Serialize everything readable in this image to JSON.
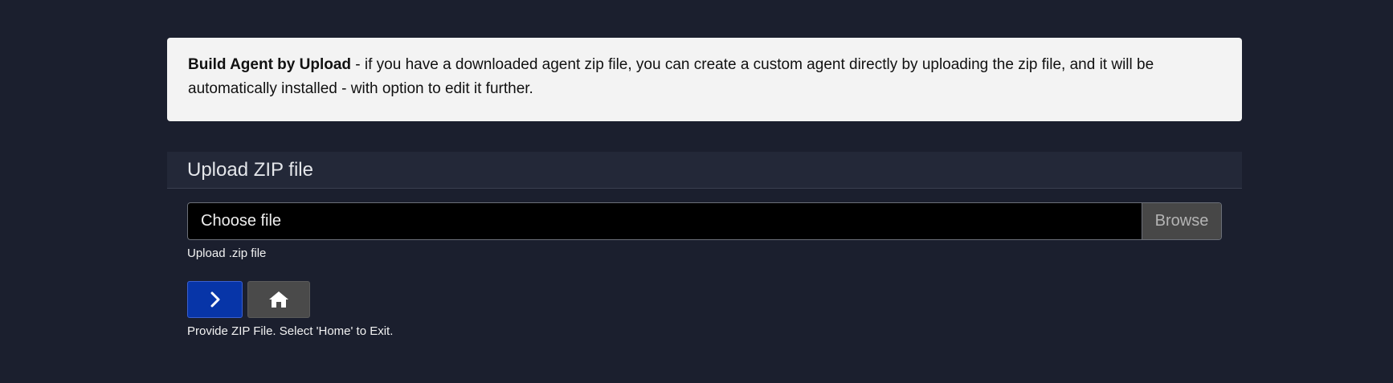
{
  "info": {
    "title": "Build Agent by Upload",
    "description": " - if you have a downloaded agent zip file, you can create a custom agent directly by uploading the zip file, and it will be automatically installed - with option to edit it further."
  },
  "upload_section": {
    "title": "Upload ZIP file",
    "file_input_label": "Choose file",
    "browse_label": "Browse",
    "help_text": "Upload .zip file"
  },
  "actions": {
    "next_icon": "chevron-right-icon",
    "home_icon": "home-icon",
    "status_text": "Provide ZIP File. Select 'Home' to Exit."
  },
  "colors": {
    "background": "#1b1f2e",
    "info_box": "#f3f3f3",
    "primary_button": "#0735a8",
    "secondary_button": "#4a4a4a"
  }
}
